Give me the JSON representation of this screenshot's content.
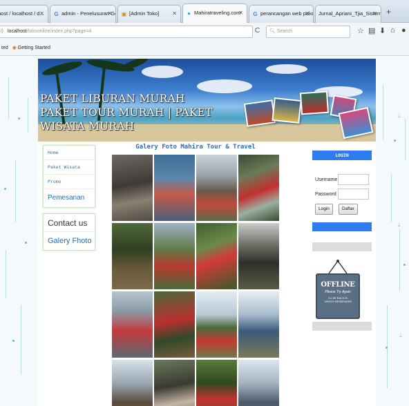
{
  "browser": {
    "tabs": [
      {
        "label": "host / localhost / d...",
        "active": false
      },
      {
        "label": "admin - Penelusuran Go...",
        "active": false
      },
      {
        "label": "[Admin Toko]",
        "active": false
      },
      {
        "label": "Mahiratraveling.com",
        "active": true
      },
      {
        "label": "perancangan web paket...",
        "active": false
      },
      {
        "label": "Jurnal_Apriani_Tjia_Sistem-I...",
        "active": false
      }
    ],
    "new_tab": "+",
    "url_host": "localhost",
    "url_path": "/tokoonline/index.php?page=4",
    "search_placeholder": "Search",
    "bookmark_left": "ted",
    "bookmark_item": "Getting Started"
  },
  "banner": {
    "line1": "PAKET LIBURAN MURAH",
    "line2": "PAKET TOUR MURAH | PAKET",
    "line3": "WISATA MURAH"
  },
  "left_menu": {
    "items": [
      "Home",
      "Paket Wisata",
      "Promo"
    ],
    "pemesanan": "Pemesanan",
    "contact": "Contact us",
    "gallery": "Galery Fhoto"
  },
  "gallery": {
    "title": "Galery Foto Mahira Tour & Travel"
  },
  "login": {
    "title": "LOGIN",
    "username_label": "Username",
    "password_label": "Password",
    "login_button": "Login",
    "daftar_button": "Daftar"
  },
  "offline_sign": {
    "main": "OFFLINE",
    "sub": "Please Try Again",
    "small1": "I'LL BE BACK IN",
    "small2": "YAHOO! MESSENGER"
  }
}
